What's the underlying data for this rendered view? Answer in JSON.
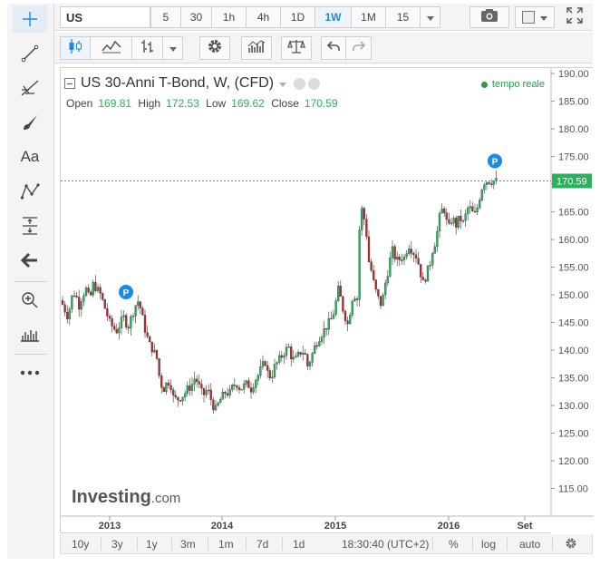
{
  "symbol": {
    "value": "US"
  },
  "intervals": [
    "5",
    "30",
    "1h",
    "4h",
    "1D",
    "1W",
    "1M",
    "15"
  ],
  "active_interval": "1W",
  "icons": {
    "crosshair": "crosshair-icon",
    "trendline": "trendline-icon",
    "fib": "fib-icon",
    "brush": "brush-icon",
    "text": "text-icon",
    "pattern": "pattern-icon",
    "measure": "measure-icon",
    "back": "back-arrow-icon",
    "zoom": "zoom-icon",
    "ruler": "ruler-icon",
    "more": "more-icon",
    "camera": "camera-icon",
    "fullscreen": "fullscreen-icon"
  },
  "left_toolbar": {
    "text_tool_label": "Aa"
  },
  "legend": {
    "title": "US 30-Anni T-Bond, W, (CFD)",
    "open_label": "Open",
    "open": "169.81",
    "high_label": "High",
    "high": "172.53",
    "low_label": "Low",
    "low": "169.62",
    "close_label": "Close",
    "close": "170.59",
    "realtime": "tempo reale"
  },
  "price_axis": {
    "ticks": [
      "190.00",
      "185.00",
      "180.00",
      "175.00",
      "170.00",
      "165.00",
      "160.00",
      "155.00",
      "150.00",
      "145.00",
      "140.00",
      "135.00",
      "130.00",
      "125.00",
      "120.00",
      "115.00"
    ],
    "current": "170.59"
  },
  "time_axis": {
    "labels": [
      "2013",
      "2014",
      "2015",
      "2016",
      "Set"
    ]
  },
  "brand": {
    "name": "Investing",
    "suffix": ".com"
  },
  "bottom_bar": {
    "ranges": [
      "10y",
      "3y",
      "1y",
      "3m",
      "1m",
      "7d",
      "1d"
    ],
    "clock": "18:30:40 (UTC+2)",
    "percent": "%",
    "log": "log",
    "auto": "auto"
  },
  "colors": {
    "up": "#2ab15b",
    "down": "#b82a2a",
    "accent": "#1e88e5",
    "price_line": "#2ab15b"
  },
  "chart_data": {
    "type": "candlestick",
    "ylim": [
      110,
      191
    ],
    "x_labels": [
      "2013",
      "2014",
      "2015",
      "2016",
      "Set"
    ],
    "last": {
      "open": 169.81,
      "high": 172.53,
      "low": 169.62,
      "close": 170.59
    },
    "close_path": [
      [
        0,
        149
      ],
      [
        4,
        147.5
      ],
      [
        8,
        146
      ],
      [
        12,
        149.5
      ],
      [
        16,
        150.5
      ],
      [
        20,
        148
      ],
      [
        24,
        150
      ],
      [
        28,
        151
      ],
      [
        32,
        149
      ],
      [
        36,
        152
      ],
      [
        40,
        151
      ],
      [
        44,
        150
      ],
      [
        48,
        148
      ],
      [
        52,
        146
      ],
      [
        54,
        145
      ],
      [
        58,
        144
      ],
      [
        62,
        143.5
      ],
      [
        66,
        145
      ],
      [
        70,
        146
      ],
      [
        74,
        144
      ],
      [
        78,
        146
      ],
      [
        82,
        148
      ],
      [
        86,
        149
      ],
      [
        90,
        146
      ],
      [
        94,
        143
      ],
      [
        98,
        141
      ],
      [
        102,
        140
      ],
      [
        106,
        138.5
      ],
      [
        108,
        136
      ],
      [
        110,
        134
      ],
      [
        114,
        133
      ],
      [
        118,
        134.5
      ],
      [
        122,
        133.5
      ],
      [
        124,
        131.5
      ],
      [
        128,
        131
      ],
      [
        132,
        131.5
      ],
      [
        136,
        132
      ],
      [
        140,
        133
      ],
      [
        144,
        133.5
      ],
      [
        148,
        135
      ],
      [
        152,
        134
      ],
      [
        154,
        132.5
      ],
      [
        158,
        132
      ],
      [
        162,
        133
      ],
      [
        166,
        131
      ],
      [
        168,
        130
      ],
      [
        172,
        129
      ],
      [
        174,
        130.5
      ],
      [
        178,
        131.5
      ],
      [
        182,
        132.5
      ],
      [
        186,
        132
      ],
      [
        190,
        133.5
      ],
      [
        194,
        134
      ],
      [
        198,
        133
      ],
      [
        202,
        133.5
      ],
      [
        206,
        134
      ],
      [
        210,
        133
      ],
      [
        214,
        134.5
      ],
      [
        218,
        135.5
      ],
      [
        222,
        137
      ],
      [
        226,
        138
      ],
      [
        228,
        136
      ],
      [
        232,
        135
      ],
      [
        236,
        137
      ],
      [
        240,
        138
      ],
      [
        244,
        139
      ],
      [
        248,
        140
      ],
      [
        252,
        140.5
      ],
      [
        254,
        139
      ],
      [
        258,
        138
      ],
      [
        262,
        139
      ],
      [
        266,
        140
      ],
      [
        270,
        139
      ],
      [
        272,
        137
      ],
      [
        276,
        138.5
      ],
      [
        280,
        140.5
      ],
      [
        284,
        142
      ],
      [
        288,
        143
      ],
      [
        292,
        144
      ],
      [
        296,
        145
      ],
      [
        300,
        146
      ],
      [
        304,
        149
      ],
      [
        306,
        151
      ],
      [
        308,
        150
      ],
      [
        312,
        147
      ],
      [
        316,
        145
      ],
      [
        318,
        144
      ],
      [
        320,
        149
      ],
      [
        324,
        150
      ],
      [
        328,
        149
      ],
      [
        330,
        165
      ],
      [
        332,
        165.5
      ],
      [
        336,
        163
      ],
      [
        338,
        160
      ],
      [
        340,
        156
      ],
      [
        342,
        155
      ],
      [
        344,
        153
      ],
      [
        348,
        150.5
      ],
      [
        350,
        149.5
      ],
      [
        354,
        148
      ],
      [
        356,
        150
      ],
      [
        358,
        152
      ],
      [
        362,
        155
      ],
      [
        364,
        157
      ],
      [
        366,
        158
      ],
      [
        368,
        157
      ],
      [
        372,
        156
      ],
      [
        376,
        157
      ],
      [
        378,
        156
      ],
      [
        380,
        157.5
      ],
      [
        384,
        159
      ],
      [
        388,
        158
      ],
      [
        392,
        157
      ],
      [
        396,
        155
      ],
      [
        398,
        153
      ],
      [
        400,
        152
      ],
      [
        404,
        154
      ],
      [
        408,
        156
      ],
      [
        410,
        158
      ],
      [
        414,
        160
      ],
      [
        418,
        164
      ],
      [
        422,
        166
      ],
      [
        424,
        165
      ],
      [
        426,
        163
      ],
      [
        428,
        162
      ],
      [
        432,
        164
      ],
      [
        436,
        162.5
      ],
      [
        440,
        164
      ],
      [
        444,
        163
      ],
      [
        446,
        164
      ],
      [
        450,
        166
      ],
      [
        454,
        165
      ],
      [
        456,
        164
      ],
      [
        460,
        166
      ],
      [
        464,
        169
      ],
      [
        466,
        170
      ],
      [
        468,
        170.59
      ]
    ],
    "markers": [
      {
        "label": "P",
        "x_index": 54,
        "price": 150.5
      },
      {
        "label": "P",
        "x_index": 461,
        "price": 174.2
      }
    ]
  }
}
